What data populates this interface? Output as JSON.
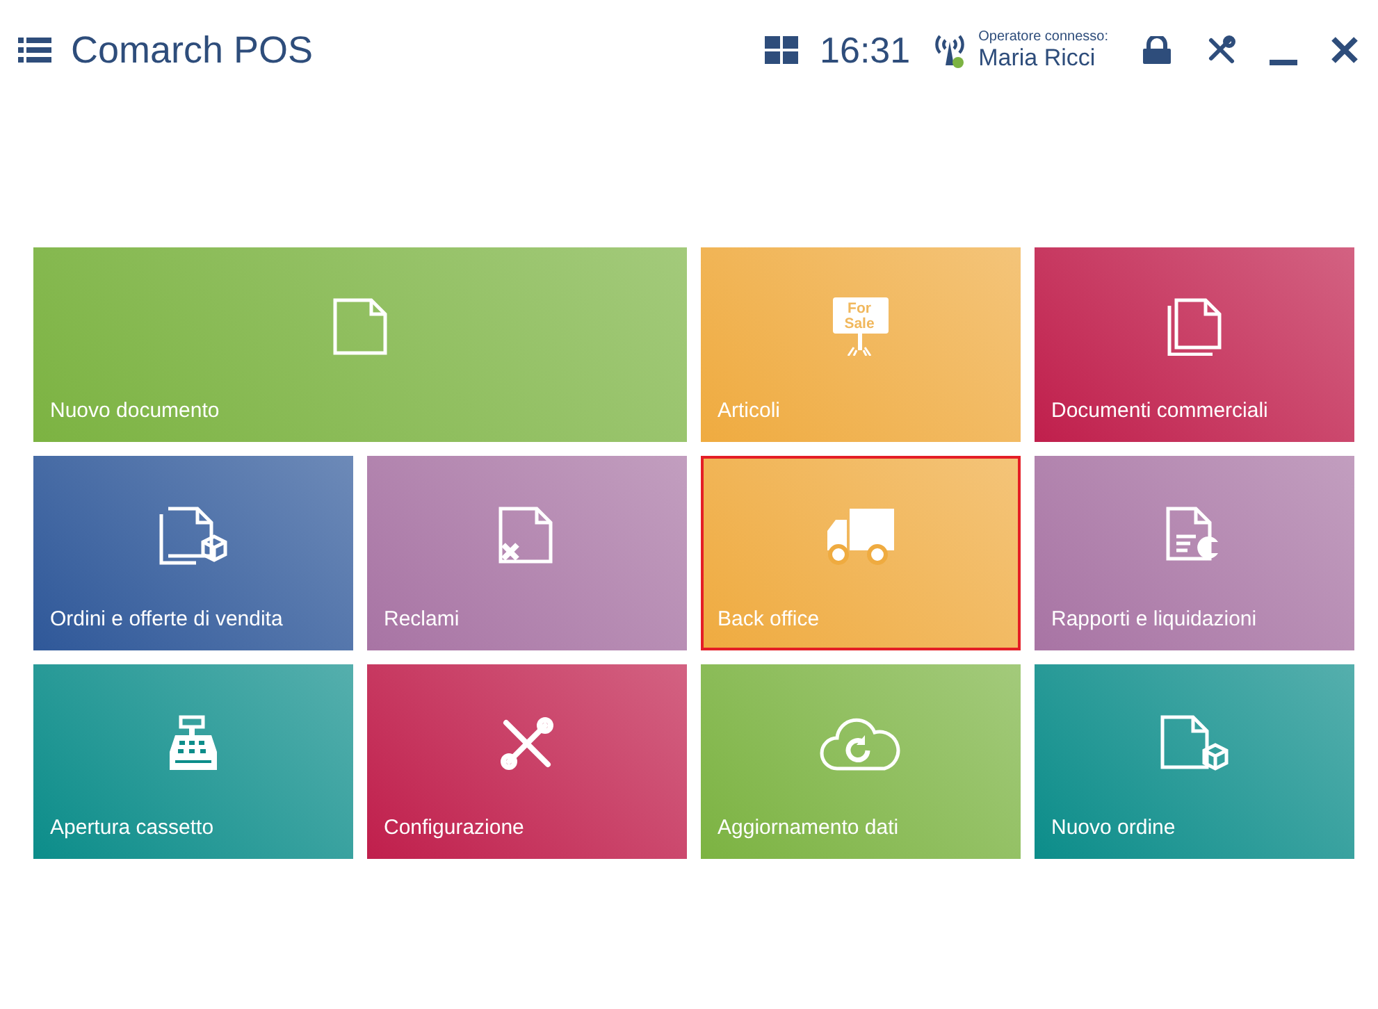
{
  "header": {
    "title": "Comarch POS",
    "time": "16:31",
    "connection": {
      "connected": true,
      "label": "Operatore connesso:",
      "user": "Maria Ricci"
    }
  },
  "tiles": [
    {
      "label": "Nuovo documento",
      "color": "#7cb342",
      "kind": "doc",
      "wide": true,
      "selected": false
    },
    {
      "label": "Articoli",
      "color": "#efab40",
      "kind": "sign",
      "sign_lines": [
        "For",
        "Sale"
      ],
      "wide": false,
      "selected": false
    },
    {
      "label": "Documenti commerciali",
      "color": "#c01f4c",
      "kind": "docs",
      "wide": false,
      "selected": false
    },
    {
      "label": "Ordini e offerte di vendita",
      "color": "#2f5899",
      "kind": "docs-box",
      "wide": false,
      "selected": false
    },
    {
      "label": "Reclami",
      "color": "#a874a4",
      "kind": "doc-x",
      "wide": false,
      "selected": false
    },
    {
      "label": "Back office",
      "color": "#efab40",
      "kind": "truck",
      "wide": false,
      "selected": true
    },
    {
      "label": "Rapporti e liquidazioni",
      "color": "#a874a4",
      "kind": "report",
      "wide": false,
      "selected": false
    },
    {
      "label": "Apertura cassetto",
      "color": "#0c8d8a",
      "kind": "register",
      "wide": false,
      "selected": false
    },
    {
      "label": "Configurazione",
      "color": "#c01f4c",
      "kind": "tools",
      "wide": false,
      "selected": false
    },
    {
      "label": "Aggiornamento dati",
      "color": "#7cb342",
      "kind": "cloud",
      "wide": false,
      "selected": false
    },
    {
      "label": "Nuovo ordine",
      "color": "#0c8d8a",
      "kind": "doc-box",
      "wide": false,
      "selected": false
    }
  ]
}
